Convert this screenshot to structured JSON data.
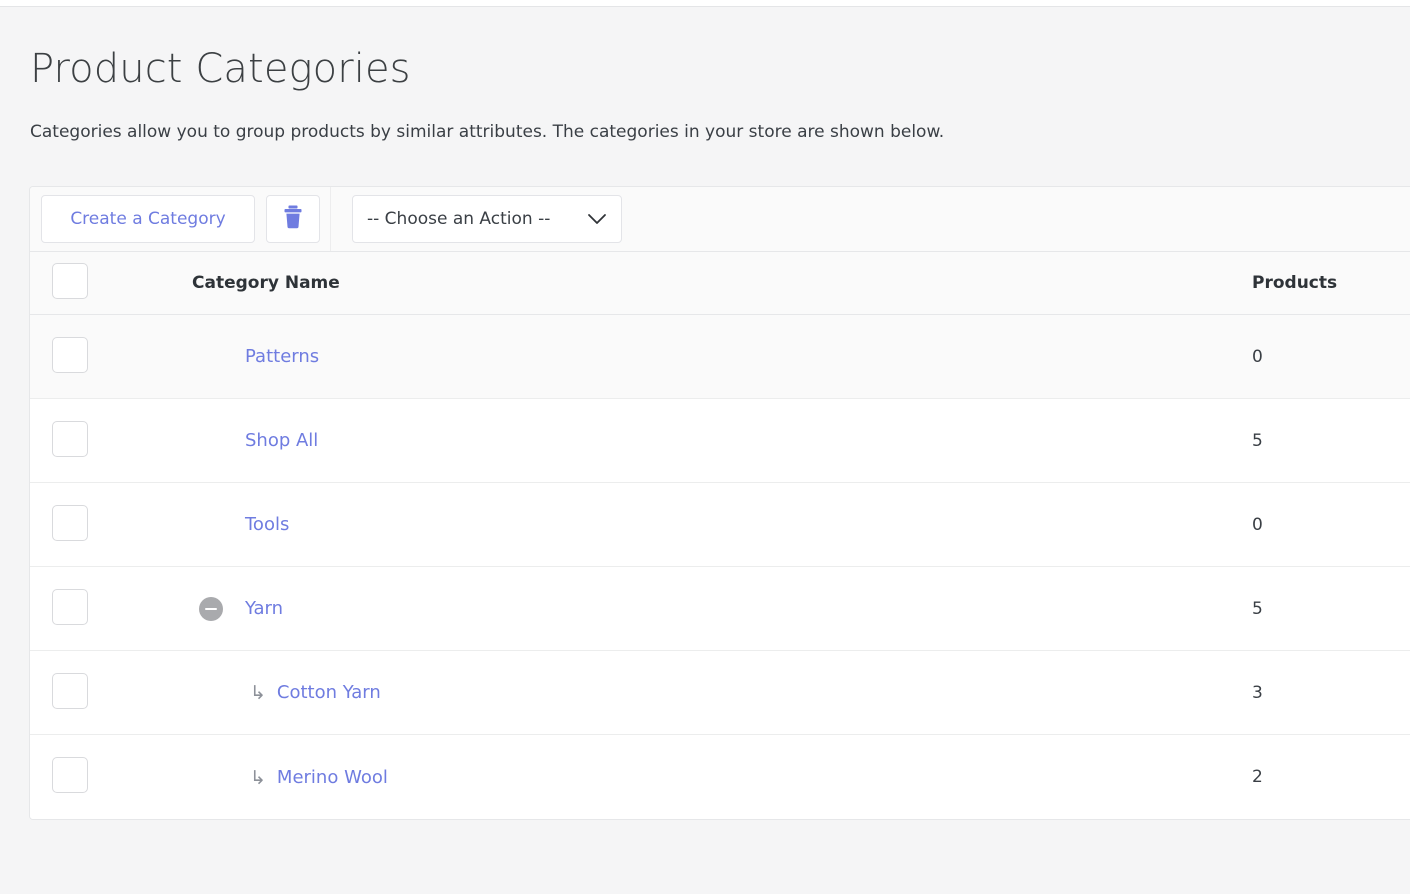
{
  "page": {
    "title": "Product Categories",
    "description": "Categories allow you to group products by similar attributes. The categories in your store are shown below."
  },
  "toolbar": {
    "create_label": "Create a Category",
    "delete_icon": "trash-icon",
    "action_select": {
      "selected": "-- Choose an Action --",
      "chevron_icon": "chevron-down-icon"
    }
  },
  "table": {
    "columns": {
      "select_all": "",
      "name": "Category Name",
      "products": "Products"
    },
    "rows": [
      {
        "name": "Patterns",
        "products": "0",
        "level": 0,
        "toggle": null,
        "shaded": true,
        "checked": false
      },
      {
        "name": "Shop All",
        "products": "5",
        "level": 0,
        "toggle": null,
        "shaded": false,
        "checked": false
      },
      {
        "name": "Tools",
        "products": "0",
        "level": 0,
        "toggle": null,
        "shaded": false,
        "checked": false
      },
      {
        "name": "Yarn",
        "products": "5",
        "level": 0,
        "toggle": "collapse",
        "shaded": false,
        "checked": false
      },
      {
        "name": "Cotton Yarn",
        "products": "3",
        "level": 1,
        "toggle": null,
        "shaded": false,
        "checked": false
      },
      {
        "name": "Merino Wool",
        "products": "2",
        "level": 1,
        "toggle": null,
        "shaded": false,
        "checked": false
      }
    ],
    "child_arrow_glyph": "↳"
  },
  "colors": {
    "link": "#6f7ce0",
    "accent": "#6f7ce0",
    "page_bg": "#f5f5f6",
    "row_shaded": "#fafafa",
    "toggle_gray": "#a9aaad"
  }
}
